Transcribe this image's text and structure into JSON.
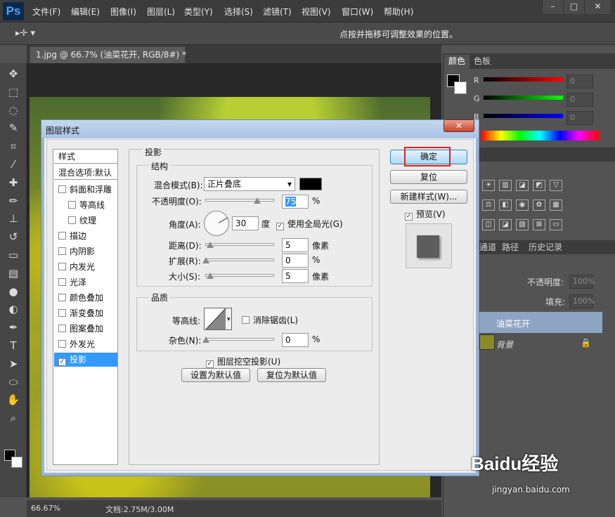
{
  "app": {
    "logo": "Ps"
  },
  "menu": [
    "文件(F)",
    "编辑(E)",
    "图像(I)",
    "图层(L)",
    "类型(Y)",
    "选择(S)",
    "滤镜(T)",
    "视图(V)",
    "窗口(W)",
    "帮助(H)"
  ],
  "options_bar": {
    "hint": "点按并拖移可调整效果的位置。"
  },
  "document": {
    "tab_title": "1.jpg @ 66.7% (油菜花开, RGB/8#) *",
    "zoom": "66.67%",
    "doc_size": "文档:2.75M/3.00M"
  },
  "panels": {
    "color_tabs": [
      "颜色",
      "色板"
    ],
    "rgb": [
      {
        "label": "R",
        "value": "0",
        "color": "#ff0000"
      },
      {
        "label": "G",
        "value": "0",
        "color": "#00ff00"
      },
      {
        "label": "B",
        "value": "0",
        "color": "#0000ff"
      }
    ],
    "layer_tabs": [
      "通道",
      "路径",
      "历史记录"
    ],
    "opacity_label": "不透明度:",
    "opacity_value": "100%",
    "fill_label": "填充:",
    "fill_value": "100%",
    "layers": [
      {
        "name": "油菜花开"
      },
      {
        "name": "背景"
      }
    ]
  },
  "dialog": {
    "title": "图层样式",
    "close": "✕",
    "styles_header": "样式",
    "blend_default": "混合选项:默认",
    "styles": [
      {
        "label": "斜面和浮雕",
        "checked": false,
        "indent": false
      },
      {
        "label": "等高线",
        "checked": false,
        "indent": true
      },
      {
        "label": "纹理",
        "checked": false,
        "indent": true
      },
      {
        "label": "描边",
        "checked": false,
        "indent": false
      },
      {
        "label": "内阴影",
        "checked": false,
        "indent": false
      },
      {
        "label": "内发光",
        "checked": false,
        "indent": false
      },
      {
        "label": "光泽",
        "checked": false,
        "indent": false
      },
      {
        "label": "颜色叠加",
        "checked": false,
        "indent": false
      },
      {
        "label": "渐变叠加",
        "checked": false,
        "indent": false
      },
      {
        "label": "图案叠加",
        "checked": false,
        "indent": false
      },
      {
        "label": "外发光",
        "checked": false,
        "indent": false
      },
      {
        "label": "投影",
        "checked": true,
        "indent": false,
        "selected": true
      }
    ],
    "section_title": "投影",
    "structure": "结构",
    "blend_mode_label": "混合模式(B):",
    "blend_mode_value": "正片叠底",
    "opacity_label": "不透明度(O):",
    "opacity_value": "75",
    "opacity_pct": 0.75,
    "percent": "%",
    "angle_label": "角度(A):",
    "angle_value": "30",
    "angle_unit": "度",
    "global_light": "使用全局光(G)",
    "global_light_checked": true,
    "distance_label": "距离(D):",
    "distance_value": "5",
    "distance_unit": "像素",
    "spread_label": "扩展(R):",
    "spread_value": "0",
    "size_label": "大小(S):",
    "size_value": "5",
    "size_unit": "像素",
    "quality": "品质",
    "contour_label": "等高线:",
    "antialias": "消除锯齿(L)",
    "antialias_checked": false,
    "noise_label": "杂色(N):",
    "noise_value": "0",
    "knockout": "图层挖空投影(U)",
    "knockout_checked": true,
    "set_default": "设置为默认值",
    "reset_default": "复位为默认值",
    "ok": "确定",
    "reset": "复位",
    "new_style": "新建样式(W)...",
    "preview": "预览(V)",
    "preview_checked": true
  },
  "watermark": {
    "brand": "Baidu经验",
    "url": "jingyan.baidu.com"
  }
}
